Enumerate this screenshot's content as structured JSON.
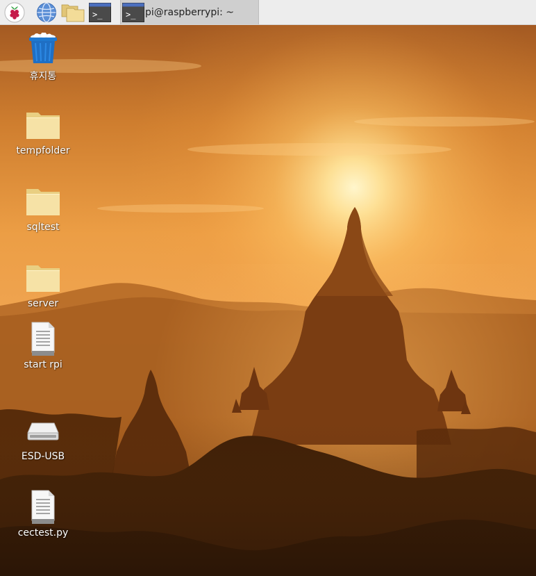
{
  "taskbar": {
    "launchers": [
      {
        "icon": "raspberry-menu-icon"
      },
      {
        "icon": "web-browser-icon"
      },
      {
        "icon": "file-manager-icon"
      },
      {
        "icon": "terminal-icon"
      }
    ],
    "tasks": [
      {
        "icon": "terminal-icon",
        "title": "pi@raspberrypi: ~"
      }
    ]
  },
  "desktop": {
    "icons": [
      {
        "label": "휴지통",
        "icon": "trash-icon"
      },
      {
        "label": "tempfolder",
        "icon": "folder-icon"
      },
      {
        "label": "sqltest",
        "icon": "folder-icon"
      },
      {
        "label": "server",
        "icon": "folder-icon"
      },
      {
        "label": "start rpi",
        "icon": "text-file-icon"
      },
      {
        "label": "ESD-USB",
        "icon": "usb-drive-icon"
      },
      {
        "label": "cectest.py",
        "icon": "text-file-icon"
      }
    ]
  },
  "colors": {
    "taskbar_bg": "#ededed",
    "active_task_bg": "#cfcfcf",
    "folder": "#f3dc98",
    "trash": "#1e78d0",
    "sky_top": "#9a5420",
    "sun_glow": "#fff2c0"
  }
}
